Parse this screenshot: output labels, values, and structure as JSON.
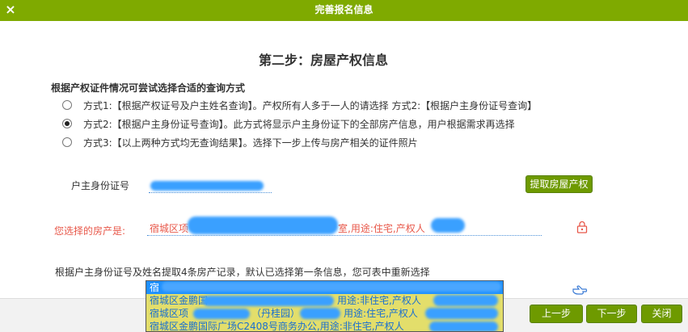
{
  "dialog": {
    "title": "完善报名信息",
    "close_icon": "×"
  },
  "step": {
    "title": "第二步：房屋产权信息"
  },
  "hint": "根据产权证件情况可尝试选择合适的查询方式",
  "options": [
    {
      "label": "方式1:【根据产权证号及户主姓名查询】。产权所有人多于一人的请选择 方式2:【根据户主身份证号查询】",
      "checked": false
    },
    {
      "label": "方式2:【根据户主身份证号查询】。此方式将显示户主身份证下的全部房产信息，用户根据需求再选择",
      "checked": true
    },
    {
      "label": "方式3:【以上两种方式均无查询结果】。选择下一步上传与房产相关的证件照片",
      "checked": false
    }
  ],
  "id_field": {
    "label": "户主身份证号"
  },
  "fetch_button": "提取房屋产权",
  "selected_property": {
    "label": "您选择的房产是:",
    "prefix": "宿城区项",
    "suffix": "室,用途:住宅,产权人"
  },
  "note": "根据户主身份证号及姓名提取4条房产记录，默认已选择第一条信息，您可表中重新选择",
  "dropdown": {
    "items": [
      {
        "text": "宿"
      },
      {
        "text": "宿城区金鹏国",
        "tail": "用途:非住宅,产权人"
      },
      {
        "text": "宿城区项",
        "mid": "（丹桂园）",
        "tail": "用途:住宅,产权人"
      },
      {
        "text": "宿城区金鹏国际广场C2408号商务办公,用途:非住宅,产权人"
      }
    ]
  },
  "footer": {
    "prev": "上一步",
    "next": "下一步",
    "close": "关闭"
  },
  "colors": {
    "titlebar": "#7faa00",
    "accent_green": "#6e9a00",
    "warning_red": "#e8584a",
    "highlight": "#1e90ff",
    "dropdown_bg": "#e3de6b"
  }
}
